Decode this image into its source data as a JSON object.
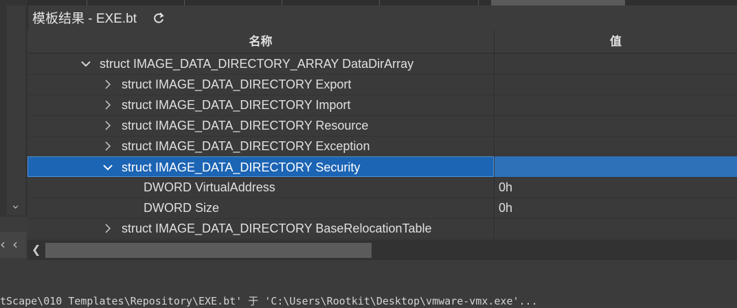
{
  "panel": {
    "title": "模板结果 - EXE.bt",
    "refresh_icon": "refresh-icon"
  },
  "columns": {
    "name": "名称",
    "value": "值"
  },
  "rows": [
    {
      "label": "struct IMAGE_DATA_DIRECTORY_ARRAY DataDirArray",
      "value": "",
      "expanded": true
    },
    {
      "label": "struct IMAGE_DATA_DIRECTORY Export",
      "value": "",
      "expanded": false
    },
    {
      "label": "struct IMAGE_DATA_DIRECTORY Import",
      "value": "",
      "expanded": false
    },
    {
      "label": "struct IMAGE_DATA_DIRECTORY Resource",
      "value": "",
      "expanded": false
    },
    {
      "label": "struct IMAGE_DATA_DIRECTORY Exception",
      "value": "",
      "expanded": false
    },
    {
      "label": "struct IMAGE_DATA_DIRECTORY Security",
      "value": "",
      "expanded": true,
      "selected": true
    },
    {
      "label": "DWORD VirtualAddress",
      "value": "0h"
    },
    {
      "label": "DWORD Size",
      "value": "0h"
    },
    {
      "label": "struct IMAGE_DATA_DIRECTORY BaseRelocationTable",
      "value": "",
      "expanded": false
    }
  ],
  "status": {
    "text": "tScape\\010 Templates\\Repository\\EXE.bt' 于 'C:\\Users\\Rootkit\\Desktop\\vmware-vmx.exe'..."
  },
  "colors": {
    "selection": "#1c64b4",
    "selection_value": "#2e71b8",
    "background": "#3a3a3a"
  }
}
